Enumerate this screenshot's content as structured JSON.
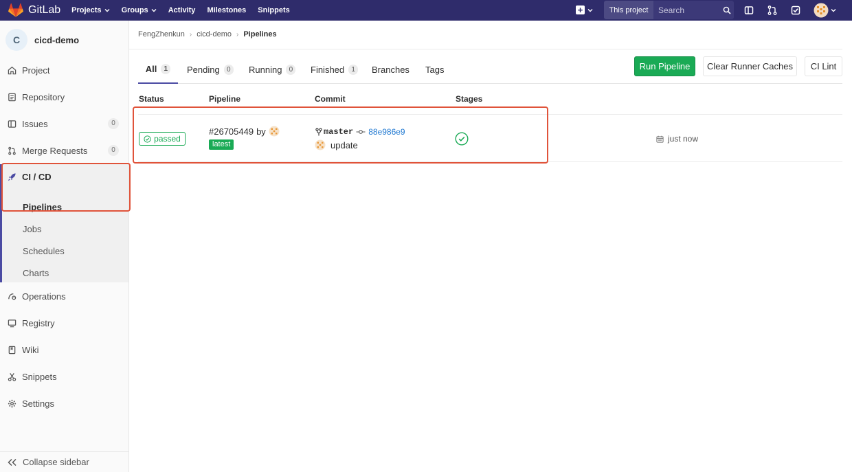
{
  "app": {
    "brand": "GitLab"
  },
  "navbar": {
    "links": [
      {
        "label": "Projects",
        "dropdown": true
      },
      {
        "label": "Groups",
        "dropdown": true
      },
      {
        "label": "Activity",
        "dropdown": false
      },
      {
        "label": "Milestones",
        "dropdown": false
      },
      {
        "label": "Snippets",
        "dropdown": false
      }
    ],
    "search_scope": "This project",
    "search_placeholder": "Search",
    "icons": [
      "plus-icon",
      "sidebar-toggle-icon",
      "merge-request-icon",
      "todo-check-icon",
      "user-avatar"
    ]
  },
  "sidebar": {
    "project_initial": "C",
    "project_name": "cicd-demo",
    "items": [
      {
        "label": "Project",
        "icon": "home-icon"
      },
      {
        "label": "Repository",
        "icon": "repository-icon"
      },
      {
        "label": "Issues",
        "icon": "issues-icon",
        "count": "0"
      },
      {
        "label": "Merge Requests",
        "icon": "merge-request-icon",
        "count": "0"
      }
    ],
    "cicd": {
      "label": "CI / CD",
      "icon": "rocket-icon",
      "sub_items": [
        "Pipelines",
        "Jobs",
        "Schedules",
        "Charts"
      ],
      "active": "Pipelines"
    },
    "lower_items": [
      {
        "label": "Operations",
        "icon": "operations-icon"
      },
      {
        "label": "Registry",
        "icon": "registry-icon"
      },
      {
        "label": "Wiki",
        "icon": "wiki-icon"
      },
      {
        "label": "Snippets",
        "icon": "snippets-icon"
      },
      {
        "label": "Settings",
        "icon": "settings-icon"
      }
    ],
    "collapse_label": "Collapse sidebar"
  },
  "breadcrumb": [
    "FengZhenkun",
    "cicd-demo",
    "Pipelines"
  ],
  "tabs": [
    {
      "label": "All",
      "count": "1",
      "active": true
    },
    {
      "label": "Pending",
      "count": "0"
    },
    {
      "label": "Running",
      "count": "0"
    },
    {
      "label": "Finished",
      "count": "1"
    },
    {
      "label": "Branches"
    },
    {
      "label": "Tags"
    }
  ],
  "buttons": {
    "run_pipeline": "Run Pipeline",
    "clear_caches": "Clear Runner Caches",
    "ci_lint": "CI Lint"
  },
  "table": {
    "headers": [
      "Status",
      "Pipeline",
      "Commit",
      "Stages"
    ],
    "rows": [
      {
        "status": "passed",
        "pipeline_id": "#26705449",
        "by": "by",
        "badge": "latest",
        "branch": "master",
        "sha": "88e986e9",
        "message": "update",
        "stage_status": "success",
        "time": "just now"
      }
    ]
  },
  "colors": {
    "navbar": "#2f2c6b",
    "accent": "#4b4ba3",
    "success": "#1aaa55",
    "link": "#1f78d1",
    "highlight": "#e0533a"
  }
}
